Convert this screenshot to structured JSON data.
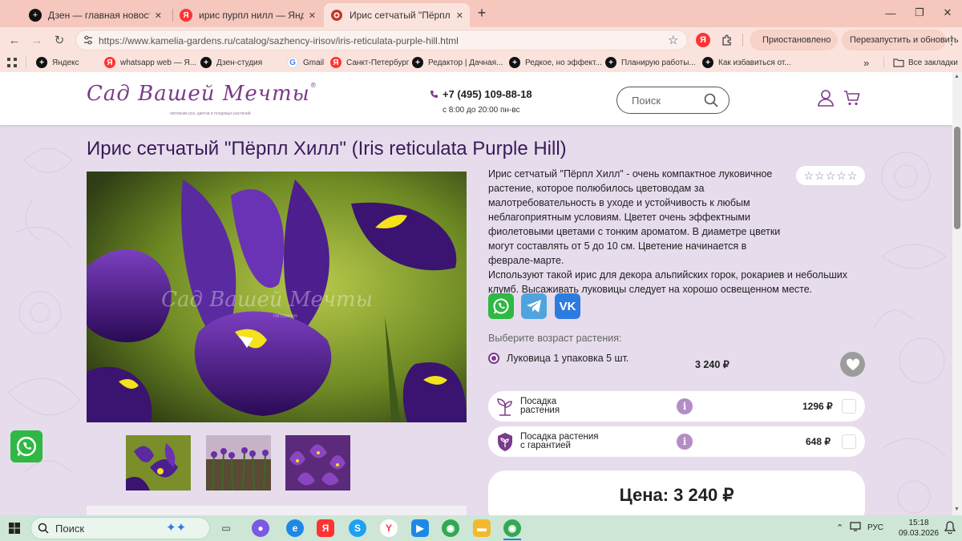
{
  "browser": {
    "tabs": [
      {
        "title": "Дзен — главная новостная ин",
        "active": false
      },
      {
        "title": "ирис пурпл нилл — Яндекс: н",
        "active": false
      },
      {
        "title": "Ирис сетчатый \"Пёрпл Хилл\" (",
        "active": true
      }
    ],
    "new_tab": "+",
    "window_controls": {
      "minimize": "—",
      "maximize": "❐",
      "close": "✕"
    },
    "url": "https://www.kamelia-gardens.ru/catalog/sazhency-irisov/iris-reticulata-purple-hill.html",
    "paused_label": "Приостановлено",
    "restart_label": "Перезапустить и обновить",
    "bookmarks": [
      {
        "label": "Яндекс",
        "icon": "plus-icon"
      },
      {
        "label": "whatsapp web — Я...",
        "icon": "yandex-icon"
      },
      {
        "label": "Дзен-студия",
        "icon": "plus-icon"
      },
      {
        "label": "Gmail",
        "icon": "google-icon"
      },
      {
        "label": "Санкт-Петербург",
        "icon": "yandex-icon"
      },
      {
        "label": "Редактор | Дачная...",
        "icon": "plus-icon"
      },
      {
        "label": "Редкое, но эффект...",
        "icon": "plus-icon"
      },
      {
        "label": "Планирую работы...",
        "icon": "plus-icon"
      },
      {
        "label": "Как избавиться от...",
        "icon": "plus-icon"
      }
    ],
    "more_bookmarks": "»",
    "all_bookmarks": "Все закладки"
  },
  "site": {
    "logo_text": "Сад Вашей Мечты",
    "logo_reg": "®",
    "logo_tagline": "питомник роз, цветов и плодовых растений",
    "phone": "+7 (495) 109-88-18",
    "hours": "с 8:00 до 20:00 пн-вс",
    "search_placeholder": "Поиск"
  },
  "product": {
    "title": "Ирис сетчатый \"Пёрпл Хилл\" (Iris reticulata Purple Hill)",
    "description_1": "Ирис сетчатый \"Пёрпл Хилл\" - очень компактное луковичное растение, которое полюбилось цветоводам за малотребовательность в уходе и устойчивость к любым неблагоприятным условиям. Цветет очень эффектными фиолетовыми цветами с тонким ароматом. В диаметре цветки могут составлять от 5 до 10 см. Цветение начинается в феврале-марте.",
    "description_2": "Используют такой ирис для декора альпийских горок, рокариев и небольших клумб. Высаживать луковицы следует на хорошо освещенном месте.",
    "rating": 0,
    "rating_max": 5,
    "watermark": "Сад Вашей Мечты",
    "watermark_sub": "питомник",
    "age_label": "Выберите возраст растения:",
    "option_label": "Луковица 1 упаковка 5 шт.",
    "option_price": "3 240 ₽",
    "services": [
      {
        "label_line1": "Посадка",
        "label_line2": "растения",
        "price": "1296 ₽",
        "icon": "sprout-icon"
      },
      {
        "label_line1": "Посадка растения",
        "label_line2": "с гарантией",
        "price": "648 ₽",
        "icon": "shield-plant-icon"
      }
    ],
    "info_glyph": "i",
    "price_text": "Цена: 3 240 ₽"
  },
  "taskbar": {
    "search": "Поиск",
    "lang": "РУС",
    "time": "15:18",
    "date": "09.03.2026"
  }
}
